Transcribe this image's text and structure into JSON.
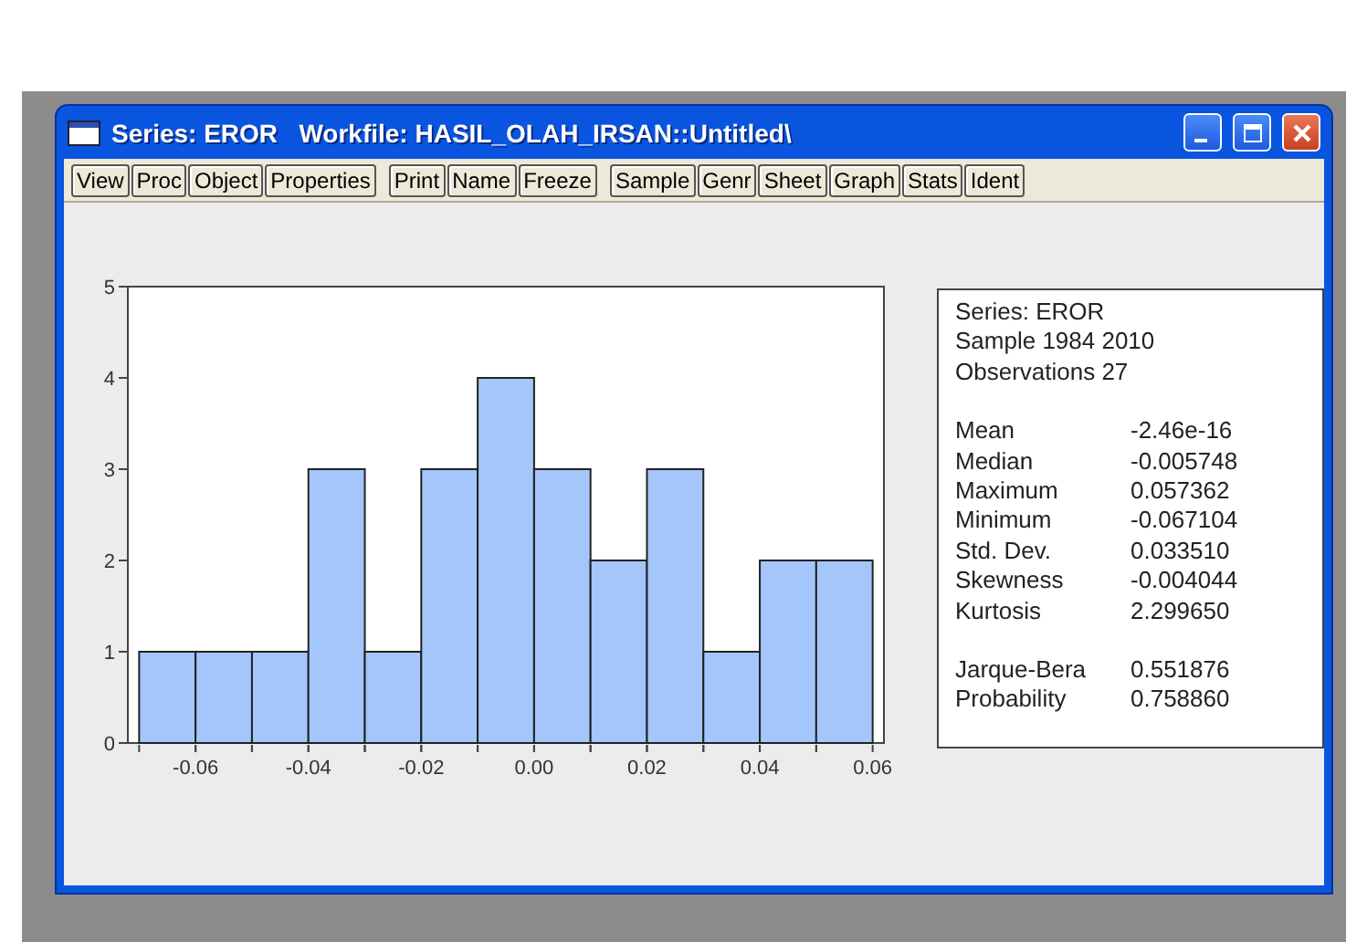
{
  "window": {
    "title": "Series: EROR   Workfile: HASIL_OLAH_IRSAN::Untitled\\"
  },
  "toolbar": {
    "groups": [
      [
        "View",
        "Proc",
        "Object",
        "Properties"
      ],
      [
        "Print",
        "Name",
        "Freeze"
      ],
      [
        "Sample",
        "Genr",
        "Sheet",
        "Graph",
        "Stats",
        "Ident"
      ]
    ]
  },
  "histogram": {
    "chart_data": {
      "type": "bar",
      "x": [
        -0.065,
        -0.055,
        -0.045,
        -0.035,
        -0.025,
        -0.015,
        -0.005,
        0.005,
        0.015,
        0.025,
        0.035,
        0.045,
        0.055
      ],
      "series": [
        {
          "color": "#a4c6fa",
          "values": [
            1,
            1,
            1,
            3,
            1,
            3,
            4,
            3,
            2,
            3,
            1,
            2,
            2
          ]
        }
      ],
      "xlim": [
        -0.072,
        0.062
      ],
      "ylim": [
        0,
        5
      ],
      "xticks": [
        {
          "value": -0.06,
          "label": "-0.06"
        },
        {
          "value": -0.04,
          "label": "-0.04"
        },
        {
          "value": -0.02,
          "label": "-0.02"
        },
        {
          "value": 0,
          "label": "0.00"
        },
        {
          "value": 0.02,
          "label": "0.02"
        },
        {
          "value": 0.04,
          "label": "0.04"
        },
        {
          "value": 0.06,
          "label": "0.06"
        }
      ],
      "yticks": [
        0,
        1,
        2,
        3,
        4,
        5
      ]
    }
  },
  "stats": {
    "header": [
      "Series: EROR",
      "Sample 1984 2010",
      "Observations 27"
    ],
    "rows": [
      {
        "label": "Mean",
        "value": "-2.46e-16"
      },
      {
        "label": "Median",
        "value": "-0.005748"
      },
      {
        "label": "Maximum",
        "value": "0.057362"
      },
      {
        "label": "Minimum",
        "value": "-0.067104"
      },
      {
        "label": "Std. Dev.",
        "value": "0.033510"
      },
      {
        "label": "Skewness",
        "value": "-0.004044"
      },
      {
        "label": "Kurtosis",
        "value": "2.299650"
      }
    ],
    "tests": [
      {
        "label": "Jarque-Bera",
        "value": "0.551876"
      },
      {
        "label": "Probability",
        "value": "0.758860"
      }
    ]
  }
}
